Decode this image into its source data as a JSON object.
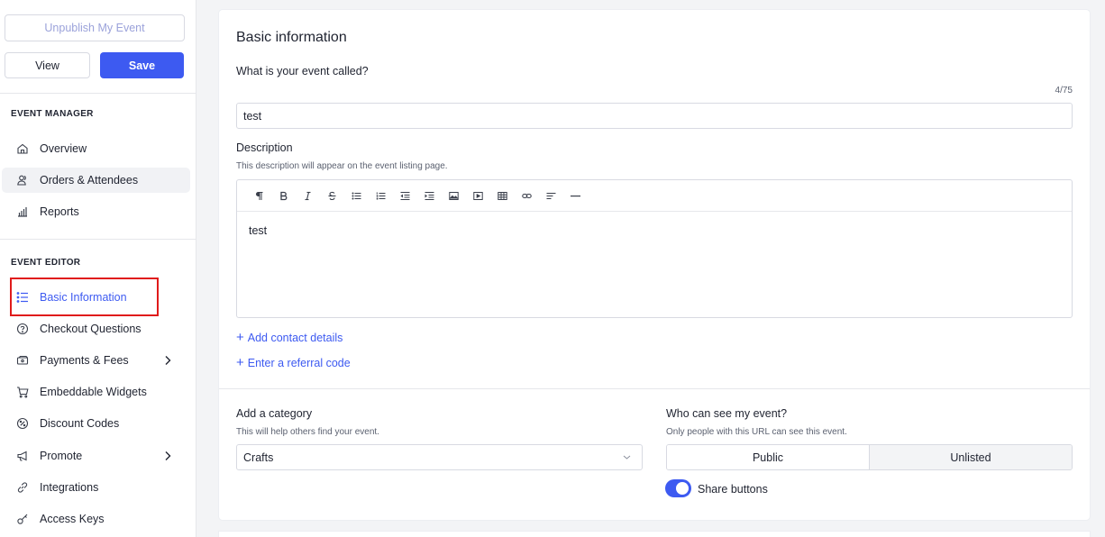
{
  "sidebar": {
    "unpublish_label": "Unpublish My Event",
    "view_label": "View",
    "save_label": "Save",
    "event_manager_title": "EVENT MANAGER",
    "event_manager_items": [
      {
        "label": "Overview",
        "icon": "home-icon"
      },
      {
        "label": "Orders & Attendees",
        "icon": "attendees-icon"
      },
      {
        "label": "Reports",
        "icon": "bar-chart-icon"
      }
    ],
    "event_editor_title": "EVENT EDITOR",
    "event_editor_items": [
      {
        "label": "Basic Information",
        "icon": "list-icon"
      },
      {
        "label": "Checkout Questions",
        "icon": "question-circle-icon"
      },
      {
        "label": "Payments & Fees",
        "icon": "payment-card-icon"
      },
      {
        "label": "Embeddable Widgets",
        "icon": "cart-icon"
      },
      {
        "label": "Discount Codes",
        "icon": "discount-icon"
      },
      {
        "label": "Promote",
        "icon": "megaphone-icon"
      },
      {
        "label": "Integrations",
        "icon": "link-icon"
      },
      {
        "label": "Access Keys",
        "icon": "key-icon"
      }
    ]
  },
  "main": {
    "title": "Basic information",
    "name_label": "What is your event called?",
    "name_counter": "4/75",
    "name_value": "test",
    "description_label": "Description",
    "description_help": "This description will appear on the event listing page.",
    "description_value": "test",
    "toolbar_icons": [
      "paragraph-icon",
      "bold-icon",
      "italic-icon",
      "strikethrough-icon",
      "bullet-list-icon",
      "ordered-list-icon",
      "outdent-icon",
      "indent-icon",
      "image-icon",
      "video-icon",
      "table-icon",
      "link-icon",
      "align-left-icon",
      "horizontal-rule-icon"
    ],
    "add_contact_label": "Add contact details",
    "referral_label": "Enter a referral code",
    "category_label": "Add a category",
    "category_help": "This will help others find your event.",
    "category_value": "Crafts",
    "visibility_label": "Who can see my event?",
    "visibility_help": "Only people with this URL can see this event.",
    "visibility_options": [
      "Public",
      "Unlisted"
    ],
    "share_label": "Share buttons",
    "accent_color": "#3d5af1"
  }
}
